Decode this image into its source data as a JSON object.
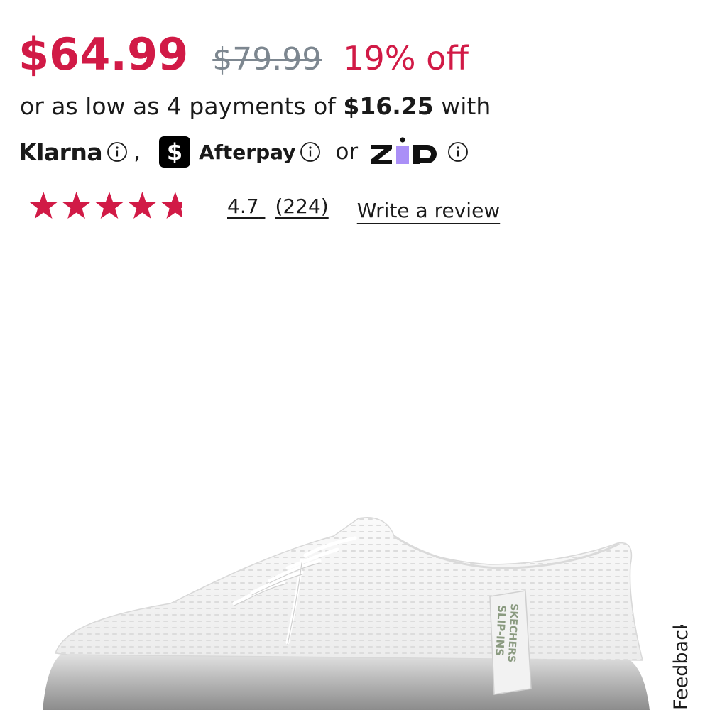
{
  "pricing": {
    "current_price": "$64.99",
    "original_price": "$79.99",
    "discount": "19% off"
  },
  "installment": {
    "prefix": "or as low as 4 payments of",
    "amount": "$16.25",
    "suffix": "with"
  },
  "providers": {
    "klarna": "Klarna",
    "comma": ",",
    "afterpay_logo_glyph": "$",
    "afterpay": "Afterpay",
    "or": "or"
  },
  "rating": {
    "value": "4.7",
    "count": "(224)",
    "stars_fraction": 0.94,
    "write_review": "Write a review"
  },
  "product": {
    "shoe_tag_line1": "SKECHERS",
    "shoe_tag_line2": "SLIP-INS"
  },
  "feedback_tab": {
    "label": "Feedback"
  },
  "colors": {
    "sale": "#d11a46",
    "strike": "#7d8790",
    "zip_purple": "#aa8ff7",
    "star": "#d11a46"
  },
  "icons": {
    "info": "info-circle-icon",
    "afterpay": "afterpay-logo-icon",
    "zip": "zip-logo-icon",
    "star": "star-icon"
  }
}
